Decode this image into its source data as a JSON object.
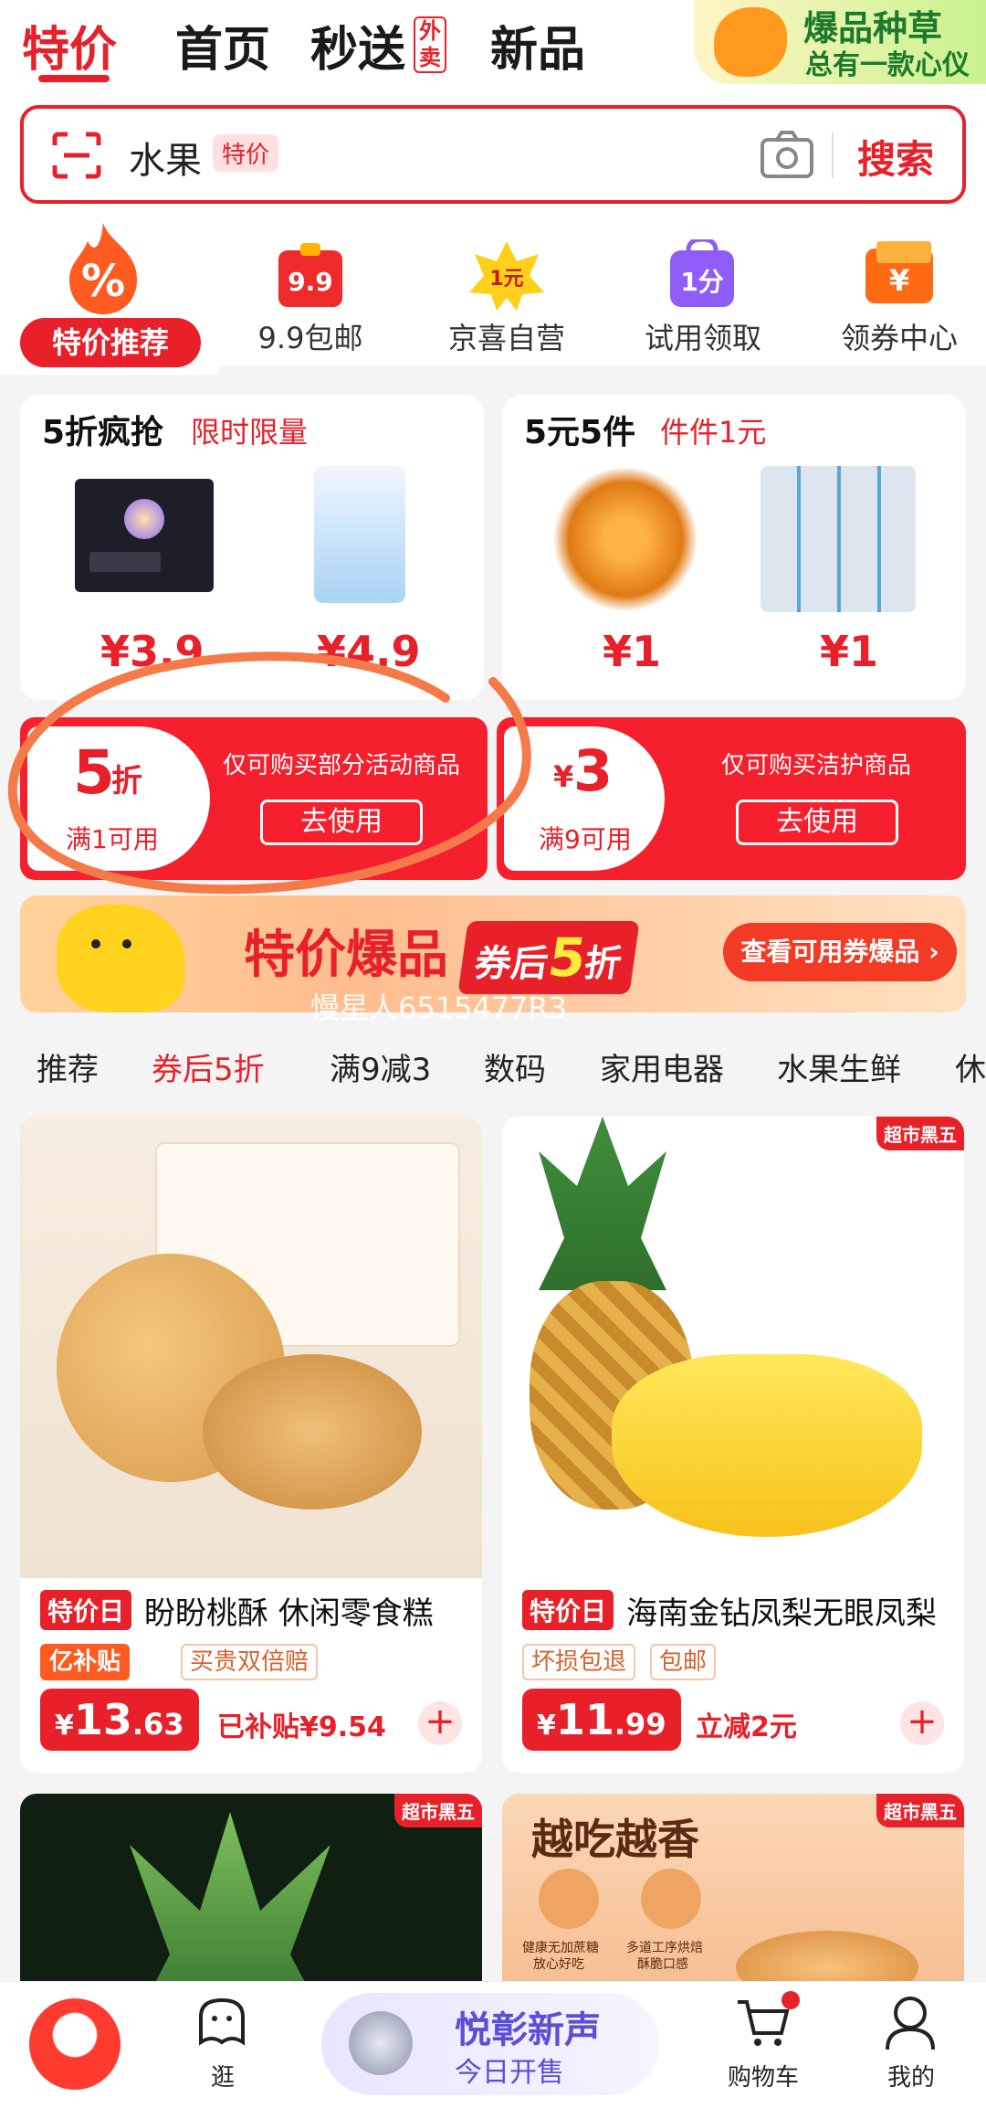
{
  "tabs": {
    "active": "特价",
    "home": "首页",
    "fast": "秒送",
    "waimai": "外卖",
    "newest": "新品"
  },
  "promo": {
    "line1": "爆品种草",
    "line2": "总有一款心仪"
  },
  "search": {
    "keyword": "水果",
    "tag": "特价",
    "button": "搜索"
  },
  "categories": [
    {
      "label": "特价推荐",
      "icon": "fire-percent-icon"
    },
    {
      "label": "9.9包邮",
      "icon": "gift-box-99-icon",
      "badge": "9.9"
    },
    {
      "label": "京喜自营",
      "icon": "yellow-star-1yuan-icon",
      "badge": "1元"
    },
    {
      "label": "试用领取",
      "icon": "purple-bag-icon",
      "badge": "1分"
    },
    {
      "label": "领券中心",
      "icon": "orange-coupon-icon",
      "badge": "¥"
    }
  ],
  "deals": [
    {
      "title": "5折疯抢",
      "subtitle": "限时限量",
      "prices": [
        "¥3.9",
        "¥4.9"
      ]
    },
    {
      "title": "5元5件",
      "subtitle": "件件1元",
      "prices": [
        "¥1",
        "¥1"
      ]
    }
  ],
  "coupons": [
    {
      "big": "5",
      "unit": "折",
      "cond": "满1可用",
      "desc": "仅可购买部分活动商品",
      "btn": "去使用"
    },
    {
      "currency": "¥",
      "big": "3",
      "cond": "满9可用",
      "desc": "仅可购买洁护商品",
      "btn": "去使用"
    }
  ],
  "banner": {
    "title": "特价爆品",
    "sub1": "券后",
    "sub2": "5",
    "sub3": "折",
    "button": "查看可用券爆品 ›",
    "watermark": "慢星人6515477R3"
  },
  "cat_tabs": [
    "推荐",
    "券后5折",
    "满9减3",
    "数码",
    "家用电器",
    "水果生鲜",
    "休"
  ],
  "products": [
    {
      "tag": "特价日",
      "name": "盼盼桃酥 休闲零食糕",
      "chips": [
        "亿补贴",
        "买贵双倍赔"
      ],
      "price_sym": "¥",
      "price_int": "13",
      "price_dec": ".63",
      "note": "已补贴¥9.54",
      "corner": ""
    },
    {
      "tag": "特价日",
      "name": "海南金钻凤梨无眼凤梨",
      "chips": [
        "坏损包退",
        "包邮"
      ],
      "price_sym": "¥",
      "price_int": "11",
      "price_dec": ".99",
      "note": "立减2元",
      "corner": "超市黑五"
    },
    {
      "corner": "超市黑五"
    },
    {
      "headline": "越吃越香",
      "feat1": "健康无加蔗糖",
      "feat1b": "放心好吃",
      "feat2": "多道工序烘焙",
      "feat2b": "酥脆口感",
      "corner": "超市黑五"
    }
  ],
  "bottom_nav": {
    "item2": "逛",
    "ad_title": "悦彰新声",
    "ad_sub": "今日开售",
    "cart": "购物车",
    "mine": "我的"
  },
  "colors": {
    "accent": "#e8202a"
  }
}
